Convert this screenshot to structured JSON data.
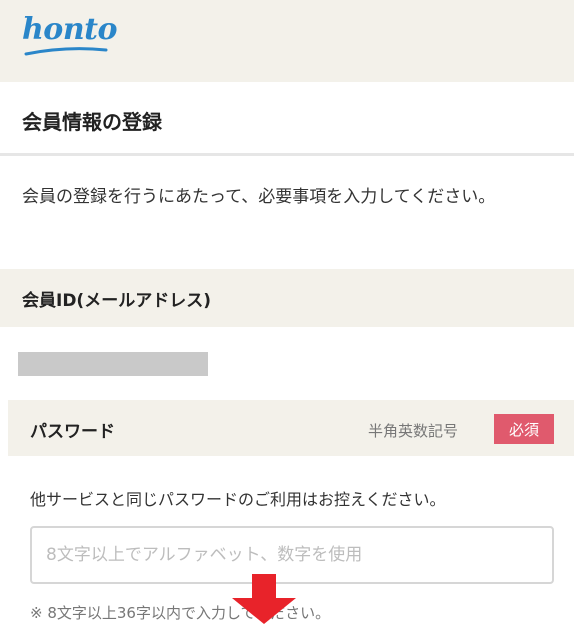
{
  "header": {
    "logo_text": "honto"
  },
  "page": {
    "title": "会員情報の登録"
  },
  "intro": {
    "text": "会員の登録を行うにあたって、必要事項を入力してください。"
  },
  "member_id": {
    "label": "会員ID(メールアドレス)"
  },
  "password": {
    "label": "パスワード",
    "hint": "半角英数記号",
    "required_badge": "必須",
    "note": "他サービスと同じパスワードのご利用はお控えください。",
    "placeholder": "8文字以上でアルファベット、数字を使用",
    "value": "",
    "caption": "※ 8文字以上36字以内で入力してください。"
  },
  "colors": {
    "header_bg": "#f3f1ea",
    "logo_blue": "#2a86c9",
    "badge_red": "#e05a6d",
    "arrow_red": "#e8232a"
  },
  "icons": {
    "overlay_arrow": "down-arrow-icon"
  }
}
